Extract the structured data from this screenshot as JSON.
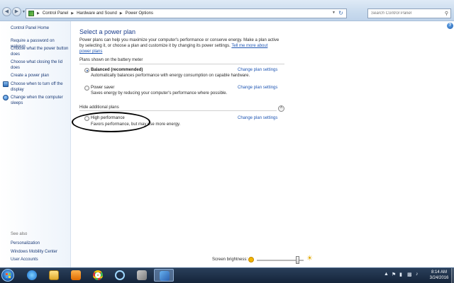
{
  "breadcrumb": [
    "Control Panel",
    "Hardware and Sound",
    "Power Options"
  ],
  "search": {
    "placeholder": "Search Control Panel"
  },
  "sidebar": {
    "links": [
      "Control Panel Home",
      "Require a password on wakeup",
      "Choose what the power button does",
      "Choose what closing the lid does",
      "Create a power plan",
      "Choose when to turn off the display",
      "Change when the computer sleeps"
    ],
    "see_also_label": "See also",
    "see_also": [
      "Personalization",
      "Windows Mobility Center",
      "User Accounts"
    ]
  },
  "main": {
    "title": "Select a power plan",
    "intro": "Power plans can help you maximize your computer's performance or conserve energy. Make a plan active by selecting it, or choose a plan and customize it by changing its power settings.",
    "intro_link": "Tell me more about power plans",
    "battery_section": "Plans shown on the battery meter",
    "additional_section": "Hide additional plans",
    "change_label": "Change plan settings",
    "plans": [
      {
        "name": "Balanced (recommended)",
        "desc": "Automatically balances performance with energy consumption on capable hardware."
      },
      {
        "name": "Power saver",
        "desc": "Saves energy by reducing your computer's performance where possible."
      },
      {
        "name": "High performance",
        "desc": "Favors performance, but may use more energy."
      }
    ],
    "selected_plan": "Balanced (recommended)"
  },
  "brightness": {
    "label": "Screen brightness:",
    "level": 0.9
  },
  "clock": {
    "time": "8:14 AM",
    "date": "3/24/2016"
  },
  "colors": {
    "link": "#1f56b3",
    "title": "#1b3e8c",
    "taskbar": "#15243a"
  }
}
